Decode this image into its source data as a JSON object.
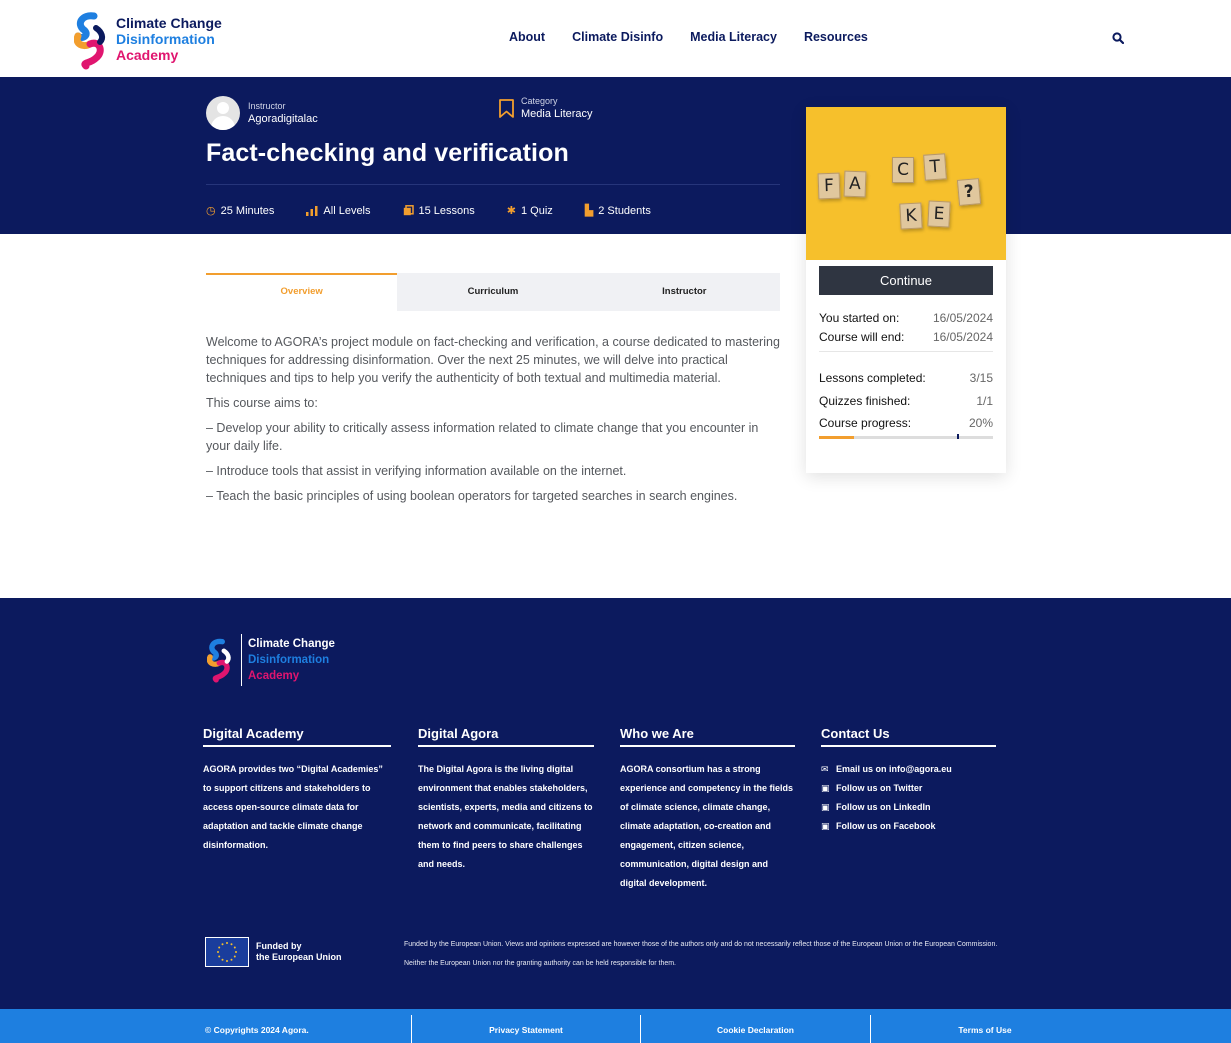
{
  "header": {
    "logo": {
      "line1": "Climate Change",
      "line2": "Disinformation",
      "line3": "Academy"
    },
    "nav": [
      "About",
      "Climate Disinfo",
      "Media Literacy",
      "Resources"
    ],
    "search_icon": "search-icon"
  },
  "hero": {
    "instructor_label": "Instructor",
    "instructor_name": "Agoradigitalac",
    "category_label": "Category",
    "category_value": "Media Literacy",
    "title": "Fact-checking and verification",
    "stats": {
      "duration": "25 Minutes",
      "level": "All Levels",
      "lessons": "15 Lessons",
      "quiz": "1 Quiz",
      "students": "2 Students"
    },
    "accent_color": "#f29e2e"
  },
  "card": {
    "image_tiles": [
      "F",
      "A",
      "C",
      "T",
      "?",
      "K",
      "E"
    ],
    "continue_label": "Continue",
    "started_label": "You started on:",
    "started_value": "16/05/2024",
    "end_label": "Course will end:",
    "end_value": "16/05/2024",
    "lessons_label": "Lessons completed:",
    "lessons_value": "3/15",
    "quizzes_label": "Quizzes finished:",
    "quizzes_value": "1/1",
    "progress_label": "Course progress:",
    "progress_value": "20%",
    "progress_fraction": 0.2
  },
  "tabs": [
    "Overview",
    "Curriculum",
    "Instructor"
  ],
  "overview": {
    "p1": "Welcome to AGORA’s project module on fact-checking and verification, a course dedicated to mastering techniques for addressing disinformation. Over the next 25 minutes, we will delve into practical techniques and tips to help you verify the authenticity of both textual and multimedia material.",
    "p2": "This course aims to:",
    "p3": "– Develop your ability to critically assess information related to climate change that you encounter in your daily life.",
    "p4": "– Introduce tools that assist in verifying information available on the internet.",
    "p5": "– Teach the basic principles of using boolean operators for targeted searches in search engines."
  },
  "footer": {
    "logo": {
      "line1": "Climate Change",
      "line2": "Disinformation",
      "line3": "Academy"
    },
    "columns": [
      {
        "title": "Digital Academy",
        "text": "AGORA provides two “Digital Academies” to support citizens and stakeholders to access open-source climate data for adaptation and tackle climate change disinformation."
      },
      {
        "title": "Digital Agora",
        "text": "The Digital Agora is the living digital environment that enables stakeholders, scientists, experts, media and citizens to network and communicate, facilitating them to find peers  to share challenges and needs."
      },
      {
        "title": "Who we Are",
        "text": "AGORA consortium has a strong experience and competency in the fields of climate science, climate change, climate adaptation, co-creation and engagement, citizen science, communication, digital design and digital development."
      }
    ],
    "contact": {
      "title": "Contact Us",
      "items": [
        "Email us on info@agora.eu",
        "Follow us on Twitter",
        "Follow us on LinkedIn",
        "Follow us on Facebook"
      ]
    },
    "eu": {
      "line1": "Funded by",
      "line2": "the European Union"
    },
    "disclaimer": "Funded by the European Union. Views and opinions expressed are however those of the authors only and do not necessarily reflect those of the European Union or the European Commission. Neither the European Union nor the granting authority can be held responsible for them."
  },
  "bottom_bar": {
    "copyright": "© Copyrights 2024 Agora.",
    "privacy": "Privacy Statement",
    "cookie": "Cookie Declaration",
    "terms": "Terms of Use"
  }
}
